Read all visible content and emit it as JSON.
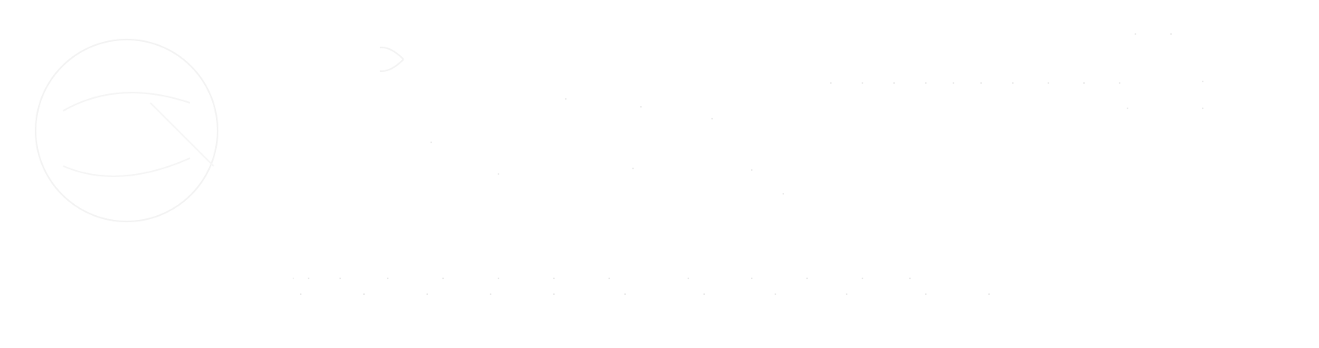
{
  "logo": {
    "icon_name": "faint-circle-logo-icon",
    "wordmark_text": "",
    "tagline_text": ""
  },
  "colors": {
    "background": "#ffffff",
    "mark": "#f4f4f4",
    "speckle": "#e6e6e6"
  }
}
